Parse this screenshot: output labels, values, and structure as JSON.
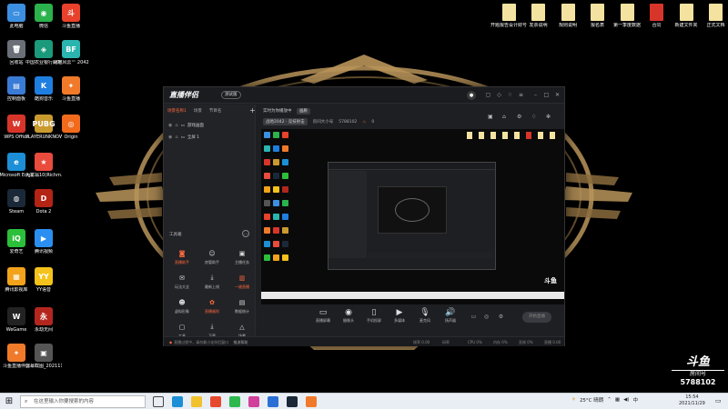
{
  "desktop": {
    "left_icons": [
      {
        "label": "此电脑",
        "glyph": "▭",
        "color": "#3c8fe0"
      },
      {
        "label": "微信",
        "glyph": "◉",
        "color": "#2bb24c"
      },
      {
        "label": "斗鱼直播",
        "glyph": "斗",
        "color": "#e8412c"
      },
      {
        "label": "回收站",
        "glyph": "🗑",
        "color": "#6a6f78"
      },
      {
        "label": "中国农业银行网银助手",
        "glyph": "◈",
        "color": "#1a9a7a"
      },
      {
        "label": "战地风云™ 2042",
        "glyph": "BF",
        "color": "#2ab5b0"
      },
      {
        "label": "控制面板",
        "glyph": "▤",
        "color": "#3a7bd5"
      },
      {
        "label": "酷狗音乐",
        "glyph": "K",
        "color": "#1f7fe0"
      },
      {
        "label": "斗鱼直播",
        "glyph": "✦",
        "color": "#f07a2a"
      },
      {
        "label": "WPS Office",
        "glyph": "W",
        "color": "#d8352a"
      },
      {
        "label": "PLAYERUNKNOWN'S BATTLEGR...",
        "glyph": "PUBG",
        "color": "#c99a2e"
      },
      {
        "label": "Origin",
        "glyph": "◎",
        "color": "#f26b1d"
      },
      {
        "label": "Microsoft Edge",
        "glyph": "e",
        "color": "#1c8fd6"
      },
      {
        "label": "大富翁10(Richm...",
        "glyph": "★",
        "color": "#e94b3c"
      },
      {
        "label": "Steam",
        "glyph": "◍",
        "color": "#1b2838"
      },
      {
        "label": "Dota 2",
        "glyph": "D",
        "color": "#b32415"
      },
      {
        "label": "爱奇艺",
        "glyph": "iQ",
        "color": "#2bbf3a"
      },
      {
        "label": "腾讯视频",
        "glyph": "▶",
        "color": "#2a8ff0"
      },
      {
        "label": "腾讯影视库",
        "glyph": "▦",
        "color": "#f2a31b"
      },
      {
        "label": "YY语音",
        "glyph": "YY",
        "color": "#f4c21a"
      },
      {
        "label": "WeGame",
        "glyph": "W",
        "color": "#222"
      },
      {
        "label": "永劫无间",
        "glyph": "永",
        "color": "#b3261e"
      },
      {
        "label": "斗鱼直播伴侣",
        "glyph": "✦",
        "color": "#f07a2a"
      },
      {
        "label": "屏幕截图_20211111...",
        "glyph": "▣",
        "color": "#555"
      }
    ],
    "right_icons": [
      {
        "label": "开题报告设计财号"
      },
      {
        "label": "发票说明"
      },
      {
        "label": "规则说明"
      },
      {
        "label": "报名表"
      },
      {
        "label": "第一季度数据"
      },
      {
        "label": "合同"
      },
      {
        "label": "新建文件夹"
      },
      {
        "label": "正式文档"
      }
    ]
  },
  "app": {
    "name": "直播伴侣",
    "version": "测试版",
    "scene_tabs": [
      "场景名称1",
      "场景",
      "节目名"
    ],
    "sources": [
      {
        "label": "游戏画面"
      },
      {
        "label": "全屏 1"
      }
    ],
    "tools_title": "工具箱",
    "tools": [
      {
        "label": "直播助手",
        "glyph": "◙",
        "hot": true
      },
      {
        "label": "房管助手",
        "glyph": "☺",
        "hot": false
      },
      {
        "label": "主播任务",
        "glyph": "▣",
        "hot": false
      },
      {
        "label": "玩法大全",
        "glyph": "✉",
        "hot": false
      },
      {
        "label": "最新上线",
        "glyph": "⤓",
        "hot": false
      },
      {
        "label": "一键直播",
        "glyph": "▥",
        "hot": true
      },
      {
        "label": "虚拟形象",
        "glyph": "☻",
        "hot": false
      },
      {
        "label": "直播福利",
        "glyph": "✿",
        "hot": true
      },
      {
        "label": "数据统计",
        "glyph": "▤",
        "hot": false
      },
      {
        "label": "工具",
        "glyph": "▢",
        "hot": false
      },
      {
        "label": "下载",
        "glyph": "⤓",
        "hot": false
      },
      {
        "label": "场景",
        "glyph": "△",
        "hot": false
      }
    ],
    "preview_title": "实时为你播放中",
    "preview_tag": "画质",
    "room": {
      "category": "战地2042 · 竞技射击",
      "extra": "房间大小号",
      "room_number": "5788102",
      "hot_count": "0"
    },
    "controls": [
      {
        "label": "直播屏幕",
        "glyph": "▭"
      },
      {
        "label": "摄像头",
        "glyph": "◉"
      },
      {
        "label": "手机投屏",
        "glyph": "▯"
      },
      {
        "label": "多媒体",
        "glyph": "▶"
      },
      {
        "label": "麦克风",
        "glyph": "🎙"
      },
      {
        "label": "扬声器",
        "glyph": "🔊"
      }
    ],
    "start_live": "开始直播",
    "status_tip": "直播过程中，请勿最小化伴侣窗口",
    "status_link": "推流帮助",
    "status_stats": [
      "帧率 0.00",
      "码率",
      "CPU 0%",
      "内存 0%",
      "丢帧 0%",
      "直播 0.00"
    ],
    "preview_watermark": "斗鱼"
  },
  "watermark": {
    "brand": "斗鱼",
    "room_label": "房间号",
    "room_number": "5788102"
  },
  "taskbar": {
    "search_placeholder": "在这里输入你要搜索的内容",
    "weather": "25°C 晴朗",
    "ime": "中",
    "time": "15:54",
    "date": "2021/11/29",
    "pinned": [
      {
        "name": "task-view",
        "color": "#444"
      },
      {
        "name": "edge",
        "color": "#1c8fd6"
      },
      {
        "name": "explorer",
        "color": "#f2c12e"
      },
      {
        "name": "chrome",
        "color": "#e64a2e"
      },
      {
        "name": "qq-music",
        "color": "#2db84d"
      },
      {
        "name": "media",
        "color": "#d1409a"
      },
      {
        "name": "mail",
        "color": "#2a6fd6"
      },
      {
        "name": "steam",
        "color": "#1b2838"
      },
      {
        "name": "douyu-companion",
        "color": "#f07a2a"
      }
    ]
  },
  "colors": {
    "accent": "#ff6a3d",
    "gold": "#c7a15a"
  }
}
